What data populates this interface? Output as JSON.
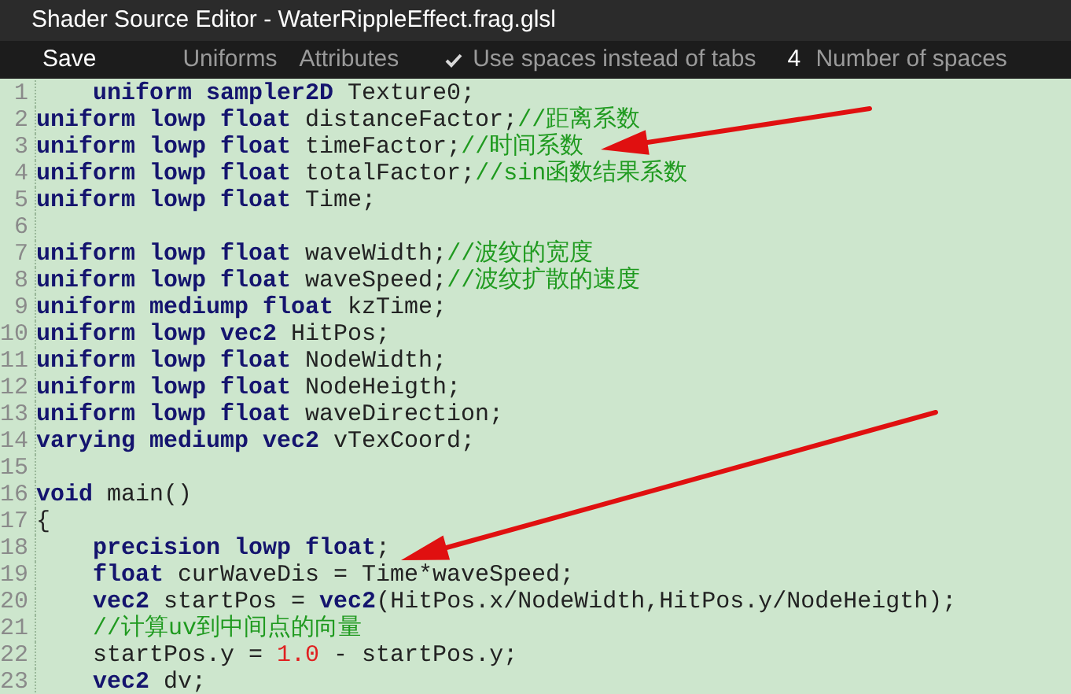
{
  "window": {
    "title": "Shader Source Editor - WaterRippleEffect.frag.glsl"
  },
  "toolbar": {
    "save": "Save",
    "buttons": [
      "Uniforms",
      "Attributes"
    ],
    "spaces_option": {
      "label": "Use spaces instead of tabs",
      "checked": true
    },
    "space_count": {
      "value": "4",
      "label": "Number of spaces"
    }
  },
  "editor": {
    "lines": [
      {
        "n": "1",
        "tokens": [
          {
            "kind": "kw",
            "text": "    uniform sampler2D"
          },
          {
            "kind": "id",
            "text": " Texture0;"
          }
        ]
      },
      {
        "n": "2",
        "tokens": [
          {
            "kind": "kw",
            "text": "uniform lowp float"
          },
          {
            "kind": "id",
            "text": " distanceFactor;"
          },
          {
            "kind": "comment",
            "text": "//距离系数"
          }
        ]
      },
      {
        "n": "3",
        "tokens": [
          {
            "kind": "kw",
            "text": "uniform lowp float"
          },
          {
            "kind": "id",
            "text": " timeFactor;"
          },
          {
            "kind": "comment",
            "text": "//时间系数"
          }
        ]
      },
      {
        "n": "4",
        "tokens": [
          {
            "kind": "kw",
            "text": "uniform lowp float"
          },
          {
            "kind": "id",
            "text": " totalFactor;"
          },
          {
            "kind": "comment",
            "text": "//sin函数结果系数"
          }
        ]
      },
      {
        "n": "5",
        "tokens": [
          {
            "kind": "kw",
            "text": "uniform lowp float"
          },
          {
            "kind": "id",
            "text": " Time;"
          }
        ]
      },
      {
        "n": "6"
      },
      {
        "n": "7",
        "tokens": [
          {
            "kind": "kw",
            "text": "uniform lowp float"
          },
          {
            "kind": "id",
            "text": " waveWidth;"
          },
          {
            "kind": "comment",
            "text": "//波纹的宽度"
          }
        ]
      },
      {
        "n": "8",
        "tokens": [
          {
            "kind": "kw",
            "text": "uniform lowp float"
          },
          {
            "kind": "id",
            "text": " waveSpeed;"
          },
          {
            "kind": "comment",
            "text": "//波纹扩散的速度"
          }
        ]
      },
      {
        "n": "9",
        "tokens": [
          {
            "kind": "kw",
            "text": "uniform mediump float"
          },
          {
            "kind": "id",
            "text": " kzTime;"
          }
        ]
      },
      {
        "n": "10",
        "tokens": [
          {
            "kind": "kw",
            "text": "uniform lowp vec2"
          },
          {
            "kind": "id",
            "text": " HitPos;"
          }
        ]
      },
      {
        "n": "11",
        "tokens": [
          {
            "kind": "kw",
            "text": "uniform lowp float"
          },
          {
            "kind": "id",
            "text": " NodeWidth;"
          }
        ]
      },
      {
        "n": "12",
        "tokens": [
          {
            "kind": "kw",
            "text": "uniform lowp float"
          },
          {
            "kind": "id",
            "text": " NodeHeigth;"
          }
        ]
      },
      {
        "n": "13",
        "tokens": [
          {
            "kind": "kw",
            "text": "uniform lowp float"
          },
          {
            "kind": "id",
            "text": " waveDirection;"
          }
        ]
      },
      {
        "n": "14",
        "tokens": [
          {
            "kind": "kw",
            "text": "varying mediump vec2"
          },
          {
            "kind": "id",
            "text": " vTexCoord;"
          }
        ]
      },
      {
        "n": "15"
      },
      {
        "n": "16",
        "tokens": [
          {
            "kind": "kw",
            "text": "void"
          },
          {
            "kind": "id",
            "text": " main()"
          }
        ]
      },
      {
        "n": "17",
        "tokens": [
          {
            "kind": "id",
            "text": "{"
          }
        ]
      },
      {
        "n": "18",
        "tokens": [
          {
            "kind": "kw",
            "text": "    precision lowp float"
          },
          {
            "kind": "id",
            "text": ";"
          }
        ]
      },
      {
        "n": "19",
        "tokens": [
          {
            "kind": "kw",
            "text": "    float"
          },
          {
            "kind": "id",
            "text": " curWaveDis = Time*waveSpeed;"
          }
        ]
      },
      {
        "n": "20",
        "tokens": [
          {
            "kind": "kw",
            "text": "    vec2"
          },
          {
            "kind": "id",
            "text": " startPos = "
          },
          {
            "kind": "kw",
            "text": "vec2"
          },
          {
            "kind": "id",
            "text": "(HitPos.x/NodeWidth,HitPos.y/NodeHeigth);"
          }
        ]
      },
      {
        "n": "21",
        "tokens": [
          {
            "kind": "comment",
            "text": "    //计算uv到中间点的向量"
          }
        ]
      },
      {
        "n": "22",
        "tokens": [
          {
            "kind": "id",
            "text": "    startPos.y = "
          },
          {
            "kind": "num",
            "text": "1.0"
          },
          {
            "kind": "id",
            "text": " - startPos.y;"
          }
        ]
      },
      {
        "n": "23",
        "tokens": [
          {
            "kind": "kw",
            "text": "    vec2"
          },
          {
            "kind": "id",
            "text": " dv;"
          }
        ]
      }
    ]
  }
}
